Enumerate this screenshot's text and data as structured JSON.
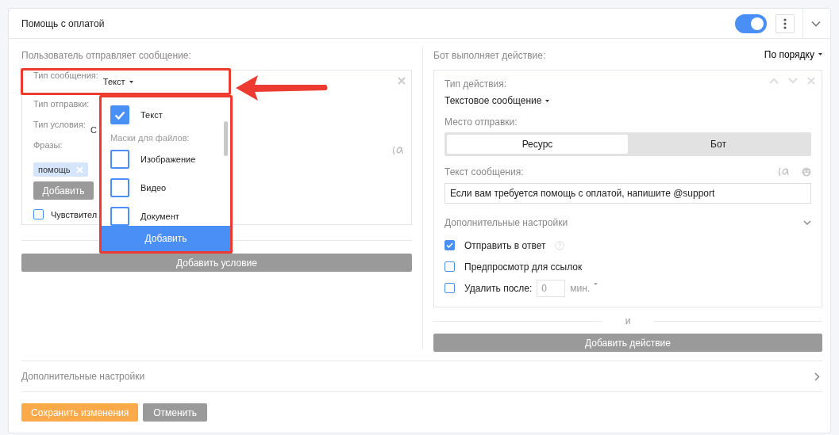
{
  "rule": {
    "title": "Помощь с оплатой",
    "enabled": true
  },
  "left": {
    "label": "Пользователь отправляет сообщение:",
    "condition": {
      "fields": [
        {
          "label": "Тип сообщения:",
          "value": "Текст"
        },
        {
          "label": "Тип отправки:"
        },
        {
          "label": "Тип условия:",
          "value": "С"
        }
      ],
      "phrases_label": "Фразы:",
      "phrases": [
        "помощь"
      ],
      "add_button": "Добавить",
      "case_sensitive": {
        "label": "Чувствител",
        "checked": false
      }
    },
    "add_button": "Добавить условие"
  },
  "dropdown": {
    "items": [
      {
        "kind": "option",
        "label": "Текст",
        "checked": true
      },
      {
        "kind": "header",
        "label": "Маски для файлов:"
      },
      {
        "kind": "option",
        "label": "Изображение",
        "checked": false
      },
      {
        "kind": "option",
        "label": "Видео",
        "checked": false
      },
      {
        "kind": "option",
        "label": "Документ",
        "checked": false
      }
    ],
    "button": "Добавить"
  },
  "right": {
    "label": "Бот выполняет действие:",
    "order": "По порядку",
    "action": {
      "type_label": "Тип действия:",
      "type_value": "Текстовое сообщение",
      "target_label": "Место отправки:",
      "targets": [
        {
          "label": "Ресурс",
          "selected": true
        },
        {
          "label": "Бот",
          "selected": false
        }
      ],
      "text_label": "Текст сообщения:",
      "text_value": "Если вам требуется помощь с оплатой, напишите @support",
      "extra_label": "Дополнительные настройки",
      "options": [
        {
          "label": "Отправить в ответ",
          "checked": true,
          "help": true
        },
        {
          "label": "Предпросмотр для ссылок",
          "checked": false
        }
      ],
      "delete_after": {
        "label": "Удалить после:",
        "checked": false,
        "placeholder": "0",
        "unit": "мин."
      }
    },
    "separator": "и",
    "add_button": "Добавить действие"
  },
  "extra_settings": "Дополнительные настройки",
  "buttons": {
    "save": "Сохранить изменения",
    "cancel": "Отменить"
  }
}
